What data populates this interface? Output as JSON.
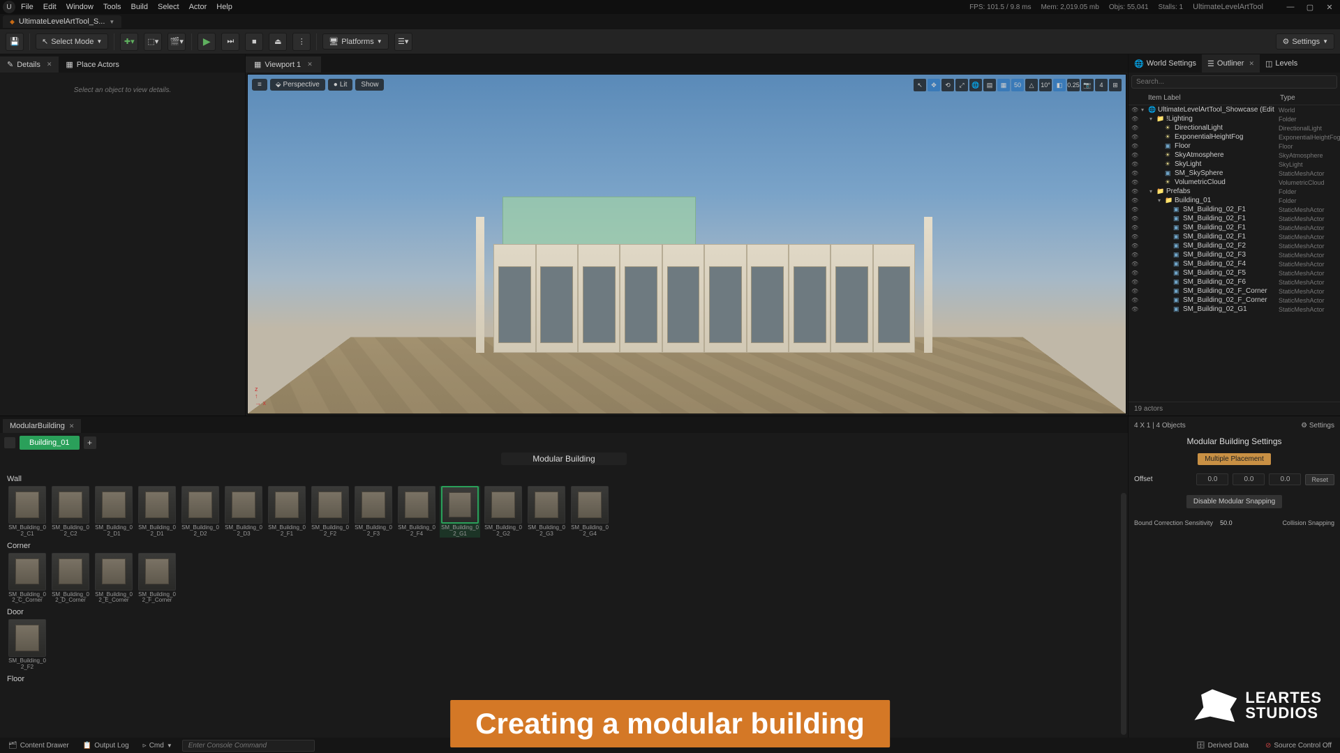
{
  "menu": [
    "File",
    "Edit",
    "Window",
    "Tools",
    "Build",
    "Select",
    "Actor",
    "Help"
  ],
  "stats": {
    "fps": "FPS: 101.5 / 9.8 ms",
    "mem": "Mem: 2,019.05 mb",
    "objs": "Objs: 55,041",
    "stalls": "Stalls: 1"
  },
  "product": "UltimateLevelArtTool",
  "docTab": "UltimateLevelArtTool_S...",
  "toolbar": {
    "selectMode": "Select Mode",
    "platforms": "Platforms",
    "settings": "Settings"
  },
  "panels": {
    "details": "Details",
    "placeActors": "Place Actors",
    "viewport": "Viewport 1",
    "worldSettings": "World Settings",
    "outliner": "Outliner",
    "levels": "Levels"
  },
  "detailsHint": "Select an object to view details.",
  "viewportBtns": {
    "perspective": "Perspective",
    "lit": "Lit",
    "show": "Show",
    "angle": "10°",
    "snap2": "0.25",
    "snap3": "4",
    "grid": "50"
  },
  "outliner": {
    "searchPlaceholder": "Search...",
    "headerLabel": "Item Label",
    "headerType": "Type",
    "tree": [
      {
        "d": 0,
        "ico": "world",
        "label": "UltimateLevelArtTool_Showcase (Edit",
        "type": "World"
      },
      {
        "d": 1,
        "ico": "folder",
        "label": "!Lighting",
        "type": "Folder"
      },
      {
        "d": 2,
        "ico": "light",
        "label": "DirectionalLight",
        "type": "DirectionalLight"
      },
      {
        "d": 2,
        "ico": "light",
        "label": "ExponentialHeightFog",
        "type": "ExponentialHeightFog"
      },
      {
        "d": 2,
        "ico": "mesh",
        "label": "Floor",
        "type": "Floor"
      },
      {
        "d": 2,
        "ico": "light",
        "label": "SkyAtmosphere",
        "type": "SkyAtmosphere"
      },
      {
        "d": 2,
        "ico": "light",
        "label": "SkyLight",
        "type": "SkyLight"
      },
      {
        "d": 2,
        "ico": "mesh",
        "label": "SM_SkySphere",
        "type": "StaticMeshActor"
      },
      {
        "d": 2,
        "ico": "light",
        "label": "VolumetricCloud",
        "type": "VolumetricCloud"
      },
      {
        "d": 1,
        "ico": "folder",
        "label": "Prefabs",
        "type": "Folder"
      },
      {
        "d": 2,
        "ico": "folder",
        "label": "Building_01",
        "type": "Folder"
      },
      {
        "d": 3,
        "ico": "mesh",
        "label": "SM_Building_02_F1",
        "type": "StaticMeshActor"
      },
      {
        "d": 3,
        "ico": "mesh",
        "label": "SM_Building_02_F1",
        "type": "StaticMeshActor"
      },
      {
        "d": 3,
        "ico": "mesh",
        "label": "SM_Building_02_F1",
        "type": "StaticMeshActor"
      },
      {
        "d": 3,
        "ico": "mesh",
        "label": "SM_Building_02_F1",
        "type": "StaticMeshActor"
      },
      {
        "d": 3,
        "ico": "mesh",
        "label": "SM_Building_02_F2",
        "type": "StaticMeshActor"
      },
      {
        "d": 3,
        "ico": "mesh",
        "label": "SM_Building_02_F3",
        "type": "StaticMeshActor"
      },
      {
        "d": 3,
        "ico": "mesh",
        "label": "SM_Building_02_F4",
        "type": "StaticMeshActor"
      },
      {
        "d": 3,
        "ico": "mesh",
        "label": "SM_Building_02_F5",
        "type": "StaticMeshActor"
      },
      {
        "d": 3,
        "ico": "mesh",
        "label": "SM_Building_02_F6",
        "type": "StaticMeshActor"
      },
      {
        "d": 3,
        "ico": "mesh",
        "label": "SM_Building_02_F_Corner",
        "type": "StaticMeshActor"
      },
      {
        "d": 3,
        "ico": "mesh",
        "label": "SM_Building_02_F_Corner",
        "type": "StaticMeshActor"
      },
      {
        "d": 3,
        "ico": "mesh",
        "label": "SM_Building_02_G1",
        "type": "StaticMeshActor"
      }
    ],
    "footer": "19 actors"
  },
  "mb": {
    "tabName": "ModularBuilding",
    "subTab": "Building_01",
    "title": "Modular Building",
    "sections": {
      "wall": {
        "label": "Wall",
        "items": [
          "SM_Building_02_C1",
          "SM_Building_02_C2",
          "SM_Building_02_D1",
          "SM_Building_02_D1",
          "SM_Building_02_D2",
          "SM_Building_02_D3",
          "SM_Building_02_F1",
          "SM_Building_02_F2",
          "SM_Building_02_F3",
          "SM_Building_02_F4",
          "SM_Building_02_G1",
          "SM_Building_02_G2",
          "SM_Building_02_G3",
          "SM_Building_02_G4"
        ],
        "selected": 10
      },
      "corner": {
        "label": "Corner",
        "items": [
          "SM_Building_02_C_Corner",
          "SM_Building_02_D_Corner",
          "SM_Building_02_E_Corner",
          "SM_Building_02_F_Corner"
        ]
      },
      "door": {
        "label": "Door",
        "items": [
          "SM_Building_02_F2"
        ]
      },
      "floor": {
        "label": "Floor",
        "items": []
      }
    },
    "info": "4 X 1  |  4 Objects",
    "settingsLabel": "Settings",
    "settingsTitle": "Modular Building Settings",
    "multiplePlacement": "Multiple Placement",
    "offset": {
      "label": "Offset",
      "x": "0.0",
      "y": "0.0",
      "z": "0.0",
      "reset": "Reset"
    },
    "disableSnapping": "Disable Modular Snapping",
    "boundCorrection": "Bound Correction Sensitivity",
    "boundValue": "50.0",
    "collisionSnapping": "Collision Snapping"
  },
  "status": {
    "contentDrawer": "Content Drawer",
    "outputLog": "Output Log",
    "cmd": "Cmd",
    "cmdPlaceholder": "Enter Console Command",
    "derivedData": "Derived Data",
    "sourceControl": "Source Control Off"
  },
  "caption": "Creating a modular building",
  "logo": {
    "line1": "LEARTES",
    "line2": "STUDIOS"
  }
}
